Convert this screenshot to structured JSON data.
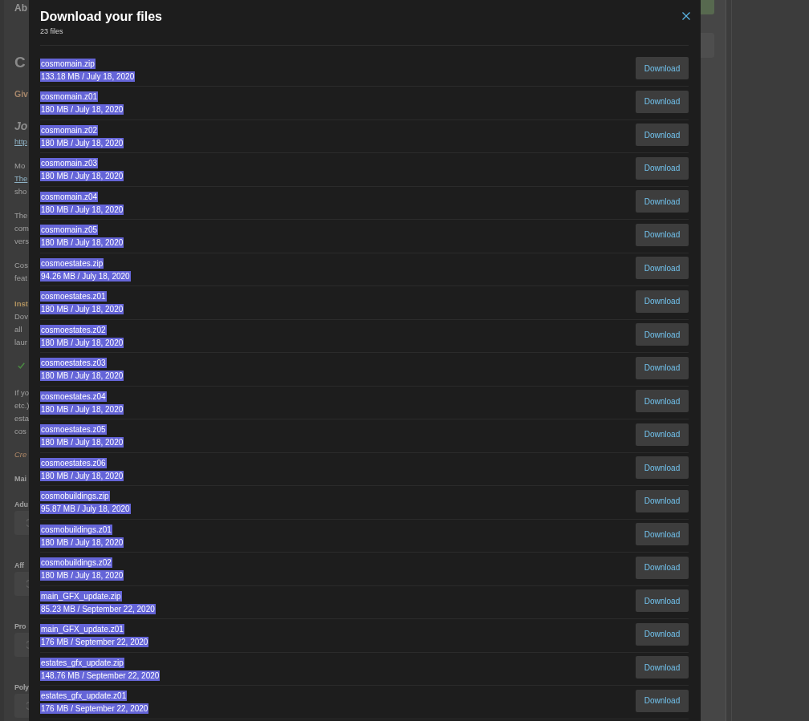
{
  "background_page": {
    "blocks": [
      {
        "kind": "heading",
        "text": "Ab"
      },
      {
        "kind": "title",
        "text": "C"
      },
      {
        "kind": "subtitle",
        "text": "Giv"
      },
      {
        "kind": "author",
        "text": "Jo"
      },
      {
        "kind": "paragraph",
        "lines": [
          {
            "text": "http",
            "link": true
          }
        ]
      },
      {
        "kind": "paragraph",
        "lines": [
          {
            "text": "Mo",
            "link": false
          },
          {
            "text": "The",
            "link": true
          },
          {
            "text": "sho",
            "link": false
          }
        ]
      },
      {
        "kind": "paragraph",
        "lines": [
          {
            "text": "The",
            "link": false
          },
          {
            "text": "com",
            "link": false
          },
          {
            "text": "vers",
            "link": false
          }
        ]
      },
      {
        "kind": "paragraph",
        "lines": [
          {
            "text": "Cos",
            "link": false
          },
          {
            "text": "feat",
            "link": false
          }
        ]
      },
      {
        "kind": "section",
        "text": "Inst"
      },
      {
        "kind": "paragraph",
        "lines": [
          {
            "text": "Dov",
            "link": false
          },
          {
            "text": "all",
            "link": false
          },
          {
            "text": "laur",
            "link": false
          }
        ]
      },
      {
        "kind": "check"
      },
      {
        "kind": "paragraph",
        "lines": [
          {
            "text": "If yo",
            "link": false
          },
          {
            "text": "etc.)",
            "link": false
          },
          {
            "text": "esta",
            "link": false
          },
          {
            "text": "cos",
            "link": false
          }
        ]
      },
      {
        "kind": "note",
        "text": "Cre"
      },
      {
        "kind": "label",
        "text": "Mai"
      },
      {
        "kind": "field",
        "label": "Adu"
      },
      {
        "kind": "field",
        "label": "Aff"
      },
      {
        "kind": "field",
        "label": "Pro"
      },
      {
        "kind": "field",
        "label": "Poly"
      }
    ]
  },
  "dialog": {
    "title": "Download your files",
    "count": "23 files",
    "files": [
      {
        "name": "cosmomain.zip",
        "info": "133.18 MB / July 18, 2020",
        "highlighted": true,
        "button": "Download"
      },
      {
        "name": "cosmomain.z01",
        "info": "180 MB / July 18, 2020",
        "highlighted": true,
        "button": "Download"
      },
      {
        "name": "cosmomain.z02",
        "info": "180 MB / July 18, 2020",
        "highlighted": true,
        "button": "Download"
      },
      {
        "name": "cosmomain.z03",
        "info": "180 MB / July 18, 2020",
        "highlighted": true,
        "button": "Download"
      },
      {
        "name": "cosmomain.z04",
        "info": "180 MB / July 18, 2020",
        "highlighted": true,
        "button": "Download"
      },
      {
        "name": "cosmomain.z05",
        "info": "180 MB / July 18, 2020",
        "highlighted": true,
        "button": "Download"
      },
      {
        "name": "cosmoestates.zip",
        "info": "94.26 MB / July 18, 2020",
        "highlighted": true,
        "button": "Download"
      },
      {
        "name": "cosmoestates.z01",
        "info": "180 MB / July 18, 2020",
        "highlighted": true,
        "button": "Download"
      },
      {
        "name": "cosmoestates.z02",
        "info": "180 MB / July 18, 2020",
        "highlighted": true,
        "button": "Download"
      },
      {
        "name": "cosmoestates.z03",
        "info": "180 MB / July 18, 2020",
        "highlighted": true,
        "button": "Download"
      },
      {
        "name": "cosmoestates.z04",
        "info": "180 MB / July 18, 2020",
        "highlighted": true,
        "button": "Download"
      },
      {
        "name": "cosmoestates.z05",
        "info": "180 MB / July 18, 2020",
        "highlighted": true,
        "button": "Download"
      },
      {
        "name": "cosmoestates.z06",
        "info": "180 MB / July 18, 2020",
        "highlighted": true,
        "button": "Download"
      },
      {
        "name": "cosmobuildings.zip",
        "info": "95.87 MB / July 18, 2020",
        "highlighted": true,
        "button": "Download"
      },
      {
        "name": "cosmobuildings.z01",
        "info": "180 MB / July 18, 2020",
        "highlighted": true,
        "button": "Download"
      },
      {
        "name": "cosmobuildings.z02",
        "info": "180 MB / July 18, 2020",
        "highlighted": true,
        "button": "Download"
      },
      {
        "name": "main_GFX_update.zip",
        "info": "85.23 MB / September 22, 2020",
        "highlighted": true,
        "button": "Download"
      },
      {
        "name": "main_GFX_update.z01",
        "info": "176 MB / September 22, 2020",
        "highlighted": true,
        "button": "Download"
      },
      {
        "name": "estates_gfx_update.zip",
        "info": "148.76 MB / September 22, 2020",
        "highlighted": true,
        "button": "Download"
      },
      {
        "name": "estates_gfx_update.z01",
        "info": "176 MB / September 22, 2020",
        "highlighted": true,
        "button": "Download"
      }
    ]
  }
}
